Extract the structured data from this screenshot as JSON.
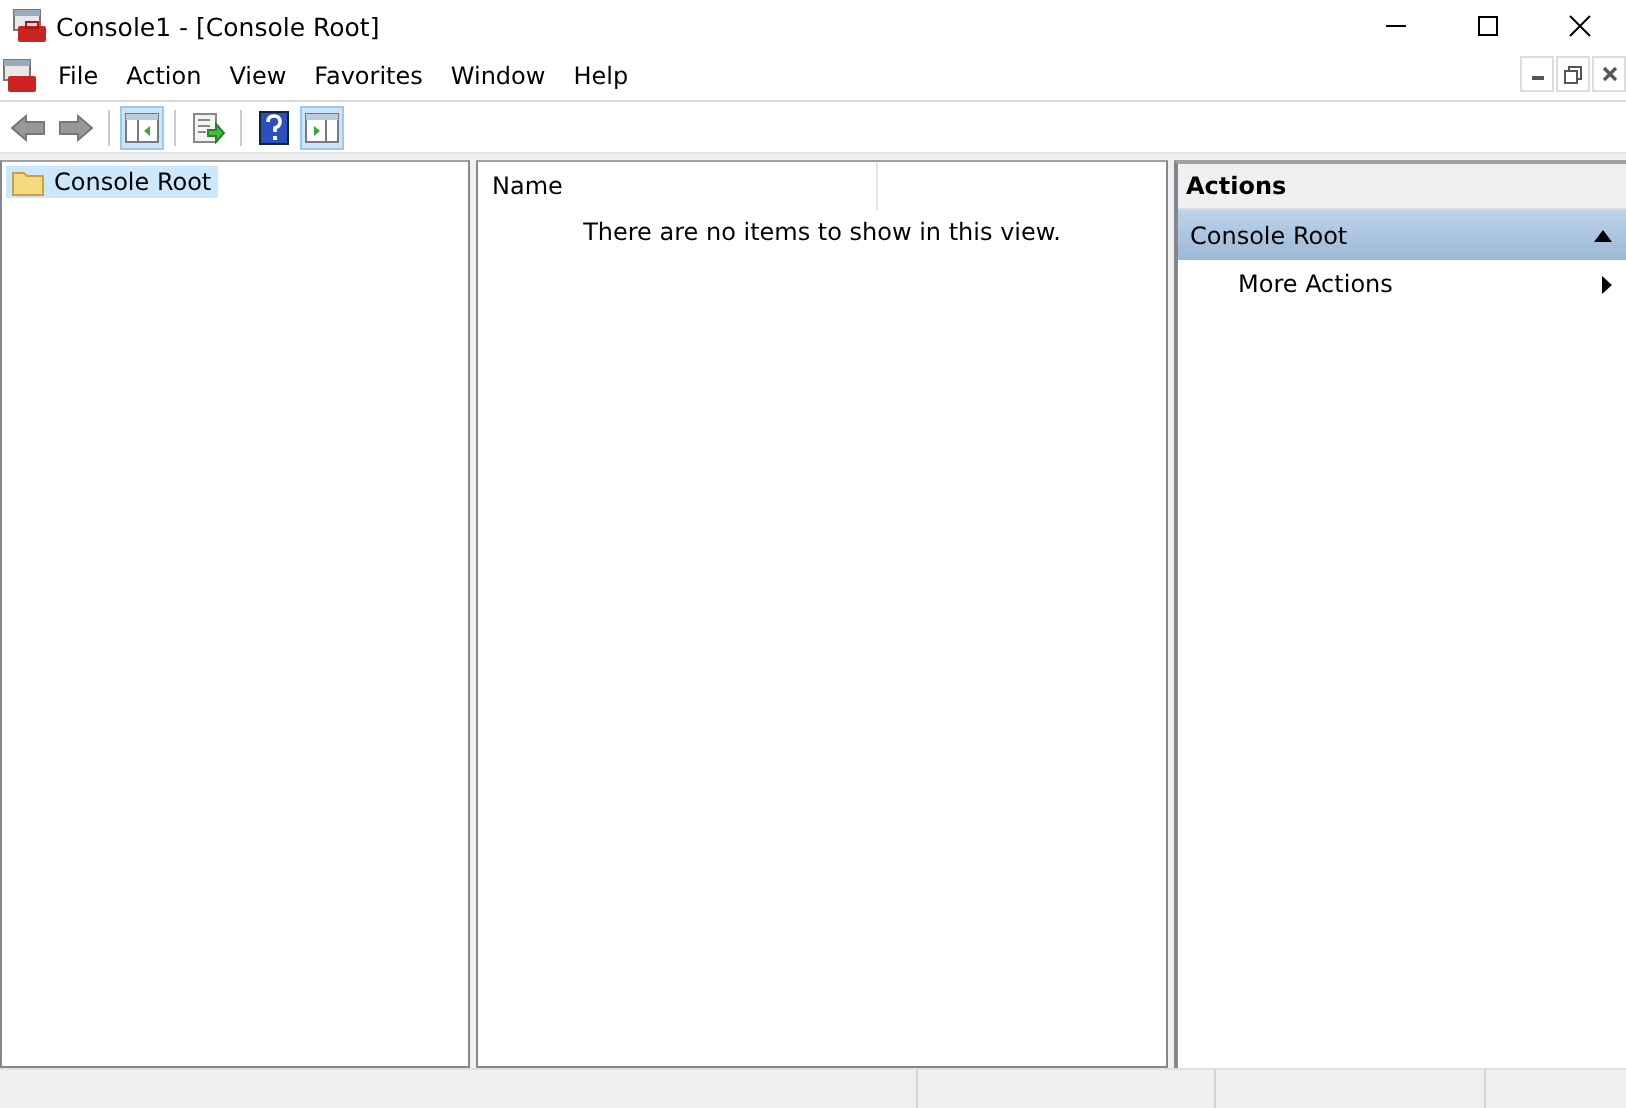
{
  "window": {
    "title": "Console1 - [Console Root]"
  },
  "menu": [
    "File",
    "Action",
    "View",
    "Favorites",
    "Window",
    "Help"
  ],
  "toolbar": [
    {
      "kind": "back",
      "on": false
    },
    {
      "kind": "forward",
      "on": false
    },
    {
      "kind": "tree",
      "on": true
    },
    {
      "kind": "export",
      "on": false
    },
    {
      "kind": "help",
      "on": false
    },
    {
      "kind": "actionpane",
      "on": true
    }
  ],
  "tree": {
    "items": [
      {
        "label": "Console Root",
        "selected": true
      }
    ]
  },
  "list": {
    "columns": [
      "Name"
    ],
    "empty_message": "There are no items to show in this view."
  },
  "actions": {
    "title": "Actions",
    "sections": [
      {
        "label": "Console Root",
        "expanded": true,
        "items": [
          "More Actions"
        ]
      }
    ]
  }
}
